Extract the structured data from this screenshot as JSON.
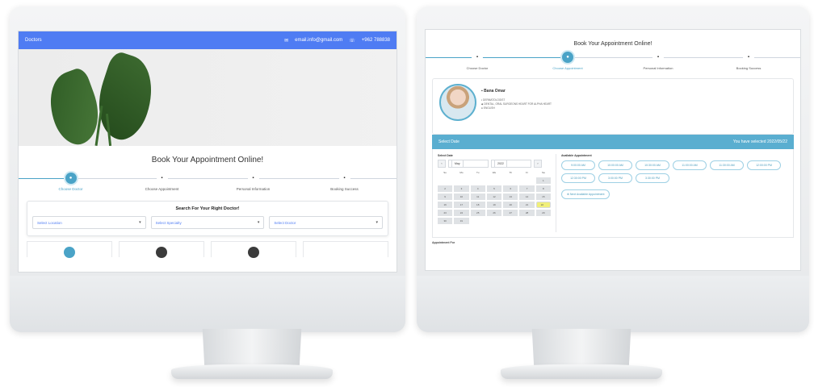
{
  "left": {
    "topbar": {
      "brand": "Doctors",
      "email": "email.info@gmail.com",
      "phone": "+962 788838"
    },
    "title": "Book Your Appointment Online!",
    "steps": [
      {
        "label": "Choose Doctor",
        "active": true
      },
      {
        "label": "Choose Appointment",
        "active": false
      },
      {
        "label": "Personal Information",
        "active": false
      },
      {
        "label": "Booking Success",
        "active": false
      }
    ],
    "search": {
      "title": "Search For Your Right Doctor!",
      "location": "Select Location",
      "specialty": "Select Specialty",
      "doctor": "Select Doctor"
    }
  },
  "right": {
    "title": "Book Your Appointment Online!",
    "steps": [
      {
        "label": "Choose Doctor",
        "active": false
      },
      {
        "label": "Choose Appointment",
        "active": true
      },
      {
        "label": "Personal Information",
        "active": false
      },
      {
        "label": "Booking Success",
        "active": false
      }
    ],
    "doctor": {
      "name": "Bana Omar",
      "line1": "DERMATOLOGIST",
      "line2": "DENTAL, ORAL SURGEONS HEART FOR ALPHA HEART",
      "line3": "ENGLISH"
    },
    "select_date": "Select Date",
    "selected_text": "You have selected 2022/05/22",
    "calendar": {
      "header": "Select Date",
      "month": "May",
      "year": "2022",
      "weekdays": [
        "Su",
        "Mo",
        "Tu",
        "We",
        "Th",
        "Fr",
        "Sa"
      ],
      "days": [
        "",
        "",
        "",
        "",
        "",
        "",
        "1",
        "2",
        "3",
        "4",
        "5",
        "6",
        "7",
        "8",
        "9",
        "10",
        "11",
        "12",
        "13",
        "14",
        "15",
        "16",
        "17",
        "18",
        "19",
        "20",
        "21",
        "22",
        "23",
        "24",
        "25",
        "26",
        "27",
        "28",
        "29",
        "30",
        "31"
      ]
    },
    "slots_header": "Available Appointment",
    "slots": [
      "9:00:00 AM",
      "10:00:00 AM",
      "10:30:00 AM",
      "11:00:00 AM",
      "11:30:00 AM",
      "12:00:00 PM",
      "12:30:00 PM",
      "3:00:00 PM",
      "3:30:00 PM"
    ],
    "next_label": "Next Available Appointment",
    "appointment_for": "Appointment For"
  }
}
